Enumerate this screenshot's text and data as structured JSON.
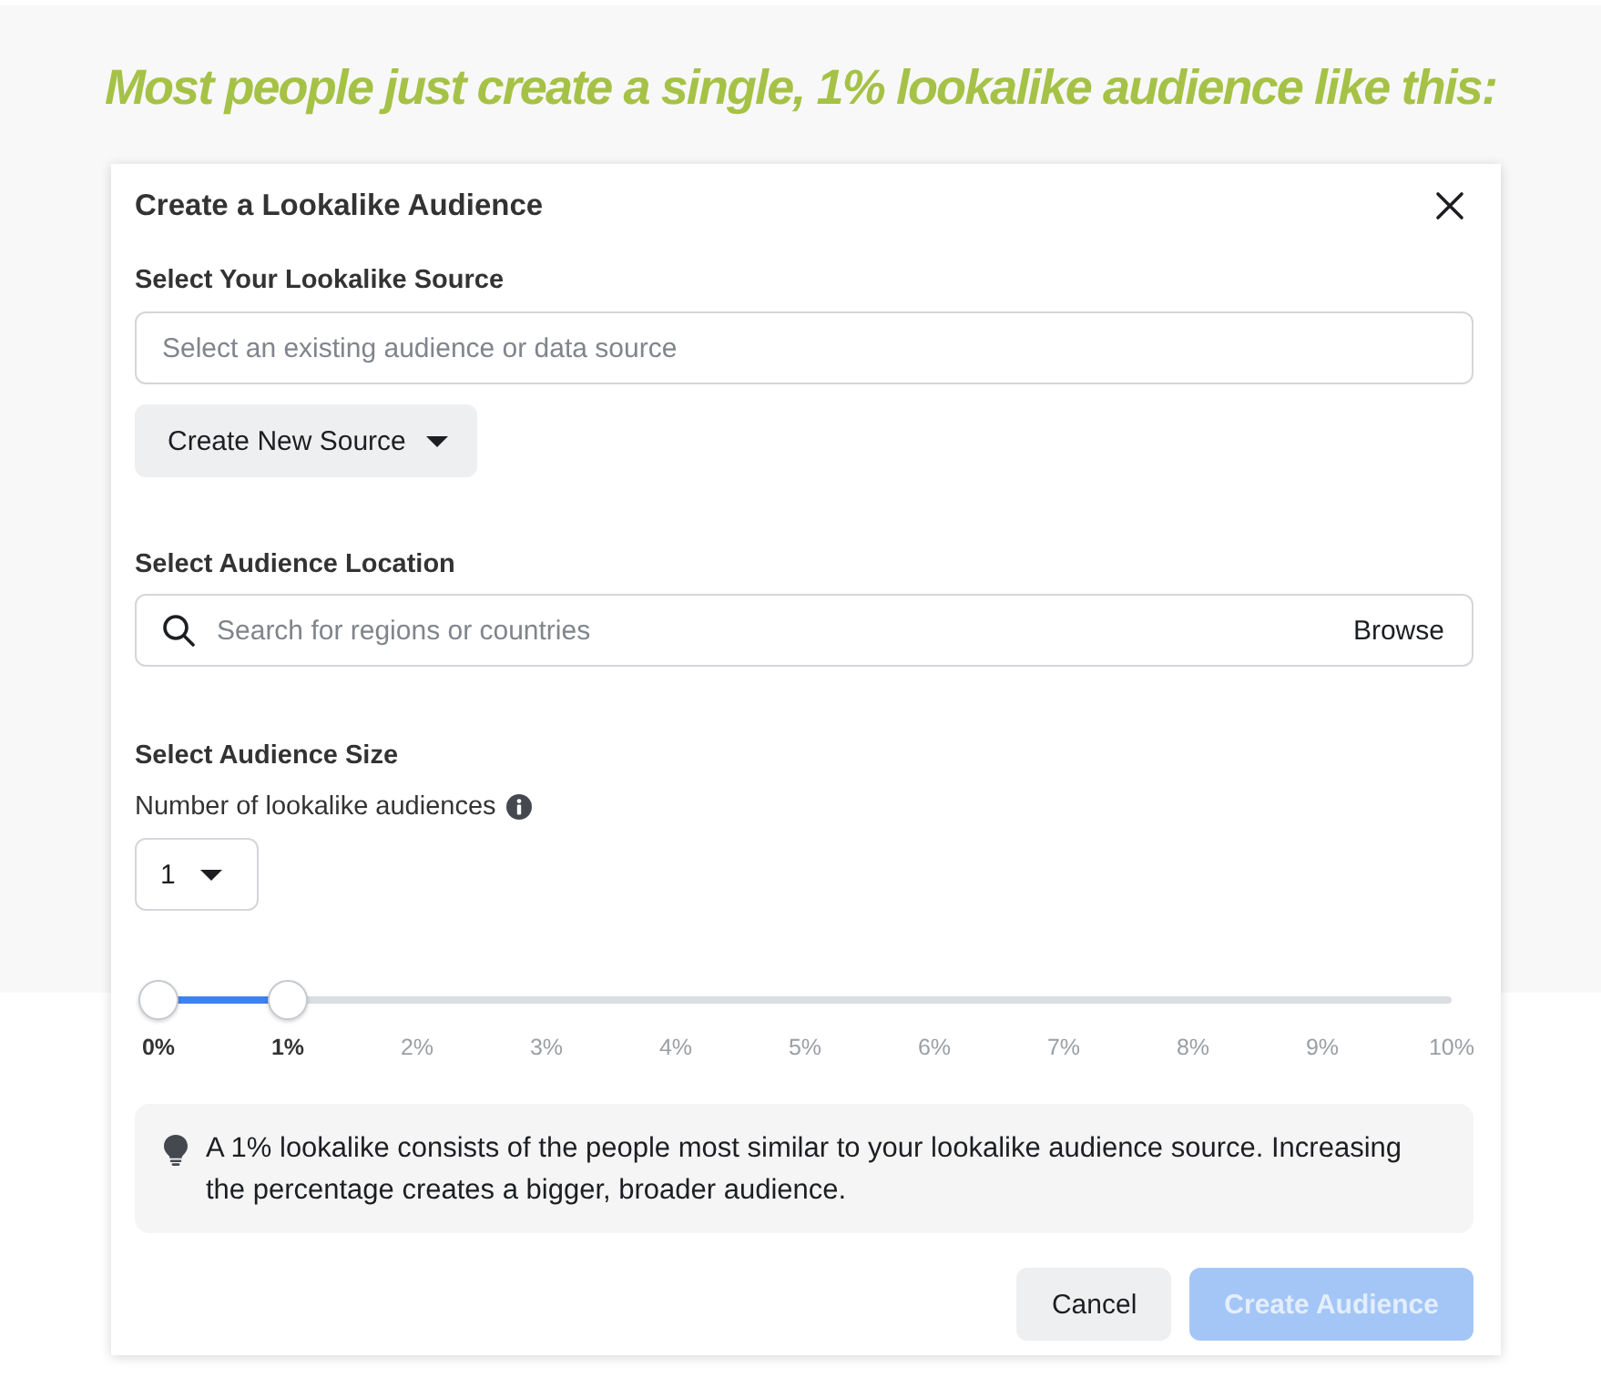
{
  "headline": "Most people just create a single, 1% lookalike audience like this:",
  "dialog": {
    "title": "Create a Lookalike Audience",
    "source": {
      "label": "Select Your Lookalike Source",
      "placeholder": "Select an existing audience or data source",
      "button": "Create New Source"
    },
    "location": {
      "label": "Select Audience Location",
      "placeholder": "Search for regions or countries",
      "browse": "Browse"
    },
    "size": {
      "label": "Select Audience Size",
      "count_label": "Number of lookalike audiences",
      "count_value": "1",
      "slider": {
        "level": 0.1,
        "ticks": [
          {
            "label": "0%",
            "active": true
          },
          {
            "label": "1%",
            "active": true
          },
          {
            "label": "2%",
            "active": false
          },
          {
            "label": "3%",
            "active": false
          },
          {
            "label": "4%",
            "active": false
          },
          {
            "label": "5%",
            "active": false
          },
          {
            "label": "6%",
            "active": false
          },
          {
            "label": "7%",
            "active": false
          },
          {
            "label": "8%",
            "active": false
          },
          {
            "label": "9%",
            "active": false
          },
          {
            "label": "10%",
            "active": false
          }
        ]
      }
    },
    "tip": "A 1% lookalike consists of the people most similar to your lookalike audience source. Increasing the percentage creates a bigger, broader audience.",
    "buttons": [
      {
        "label": "Cancel",
        "kind": "secondary",
        "disabled": false
      },
      {
        "label": "Create Audience",
        "kind": "primary",
        "disabled": true
      }
    ]
  }
}
